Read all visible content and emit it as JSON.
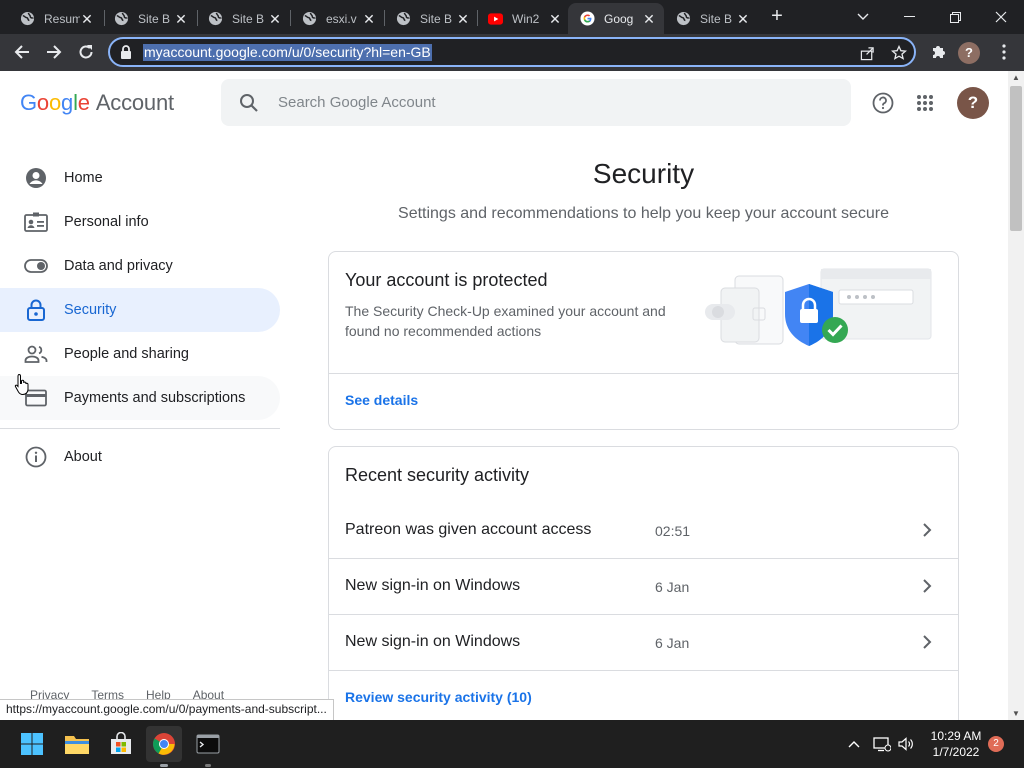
{
  "browser": {
    "tabs": [
      {
        "title": "Resum",
        "icon": "globe-icon",
        "active": false
      },
      {
        "title": "Site B",
        "icon": "globe-icon",
        "active": false
      },
      {
        "title": "Site B",
        "icon": "globe-icon",
        "active": false
      },
      {
        "title": "esxi.v",
        "icon": "globe-icon",
        "active": false
      },
      {
        "title": "Site B",
        "icon": "globe-icon",
        "active": false
      },
      {
        "title": "Win2",
        "icon": "youtube-icon",
        "active": false
      },
      {
        "title": "Goog",
        "icon": "google-icon",
        "active": true
      },
      {
        "title": "Site B",
        "icon": "globe-icon",
        "active": false
      }
    ],
    "url": "myaccount.google.com/u/0/security?hl=en-GB",
    "profile_initial": "?"
  },
  "header": {
    "logo_letters": [
      "G",
      "o",
      "o",
      "g",
      "l",
      "e"
    ],
    "logo_suffix": "Account",
    "search_placeholder": "Search Google Account",
    "avatar_initial": "?"
  },
  "nav": {
    "items": [
      {
        "label": "Home",
        "icon": "home-icon"
      },
      {
        "label": "Personal info",
        "icon": "id-card-icon"
      },
      {
        "label": "Data and privacy",
        "icon": "toggle-icon"
      },
      {
        "label": "Security",
        "icon": "lock-icon",
        "active": true
      },
      {
        "label": "People and sharing",
        "icon": "people-icon"
      },
      {
        "label": "Payments and subscriptions",
        "icon": "credit-card-icon"
      }
    ],
    "about": {
      "label": "About",
      "icon": "info-icon"
    }
  },
  "footer_links": [
    "Privacy",
    "Terms",
    "Help",
    "About"
  ],
  "main": {
    "title": "Security",
    "subtitle": "Settings and recommendations to help you keep your account secure",
    "protected_card": {
      "title": "Your account is protected",
      "description": "The Security Check-Up examined your account and found no recommended actions",
      "link": "See details"
    },
    "activity_card": {
      "title": "Recent security activity",
      "rows": [
        {
          "text": "Patreon was given account access",
          "time": "02:51"
        },
        {
          "text": "New sign-in on Windows",
          "time": "6 Jan"
        },
        {
          "text": "New sign-in on Windows",
          "time": "6 Jan"
        }
      ],
      "review_link": "Review security activity (10)"
    }
  },
  "status_url": "https://myaccount.google.com/u/0/payments-and-subscript...",
  "taskbar": {
    "time": "10:29 AM",
    "date": "1/7/2022",
    "notification_count": "2"
  },
  "colors": {
    "accent": "#1a73e8",
    "active_nav_bg": "#e8f0fe",
    "chrome_dark": "#202124"
  }
}
